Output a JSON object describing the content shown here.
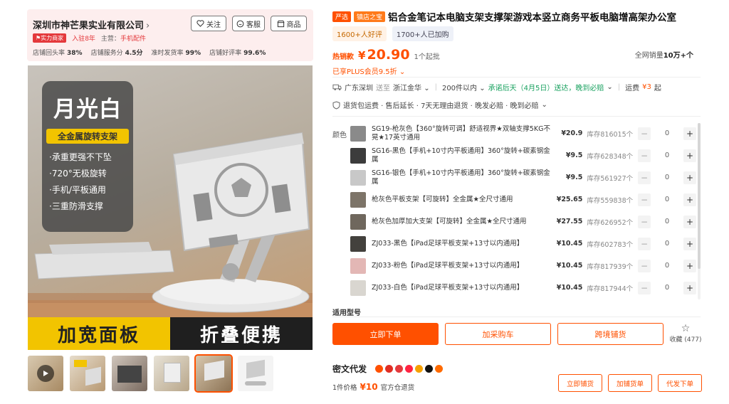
{
  "shop": {
    "name": "深圳市神芒果实业有限公司",
    "follow_label": "关注",
    "service_label": "客服",
    "store_label": "商品",
    "badge": "实力商家",
    "years_label": "入驻",
    "years_value": "8年",
    "business_label": "主营：",
    "business_value": "手机配件",
    "stats": [
      {
        "label": "店铺回头率",
        "value": "38%"
      },
      {
        "label": "店铺服务分",
        "value": "4.5分"
      },
      {
        "label": "准时发货率",
        "value": "99%"
      },
      {
        "label": "店铺好评率",
        "value": "99.6%"
      }
    ]
  },
  "image": {
    "badge_title": "月光白",
    "badge_sub": "全金属旋转支架",
    "features": [
      "·承重更强不下坠",
      "·720°无极旋转",
      "·手机/平板通用",
      "·三重防滑支撑"
    ],
    "banner_left": "加宽面板",
    "banner_right": "折叠便携"
  },
  "thumbnails": [
    "video",
    "thumb-2",
    "thumb-3",
    "thumb-4",
    "thumb-5",
    "thumb-6"
  ],
  "product": {
    "tag_strict": "严选",
    "tag_town": "镇店之宝",
    "title": "铝合金笔记本电脑支架支撑架游戏本竖立商务平板电脑增高架办公室",
    "review_good": "1600+人好评",
    "review_cart": "1700+人已加购",
    "price_label": "热销款",
    "price_symbol": "¥",
    "price": "20.90",
    "min_order": "1个起批",
    "sales_label": "全网销量",
    "sales_value": "10万+个",
    "plus_discount": "已享PLUS会员9.5折"
  },
  "shipping": {
    "from": "广东深圳",
    "to_label": "送至",
    "to": "浙江金华",
    "qty_range": "200件以内",
    "promise": "承诺后天（4月5日）送达，晚到必赔",
    "fee_label": "运费",
    "fee_value": "¥3",
    "fee_unit": "起"
  },
  "services": "退货包运费 · 售后延长 · 7天无理由退货 · 晚发必赔 · 晚到必赔",
  "color_label": "颜色",
  "skus": [
    {
      "name": "SG19-枪灰色【360°旋转可调】舒适视界★双轴支撑5KG不晃★17英寸通用",
      "price": "¥20.9",
      "stock": "库存816015个",
      "qty": "0",
      "color": "#8a8a8a"
    },
    {
      "name": "SG16-黑色【手机+10寸内平板通用】360°旋转+碳素钢金属",
      "price": "¥9.5",
      "stock": "库存628348个",
      "qty": "0",
      "color": "#3c3c3c"
    },
    {
      "name": "SG16-银色【手机+10寸内平板通用】360°旋转+碳素钢金属",
      "price": "¥9.5",
      "stock": "库存561927个",
      "qty": "0",
      "color": "#c8c8c8"
    },
    {
      "name": "枪灰色平板支架【可旋转】全金属★全尺寸通用",
      "price": "¥25.65",
      "stock": "库存559838个",
      "qty": "0",
      "color": "#7d7468"
    },
    {
      "name": "枪灰色加厚加大支架【可旋转】全金属★全尺寸通用",
      "price": "¥27.55",
      "stock": "库存626952个",
      "qty": "0",
      "color": "#6f675d"
    },
    {
      "name": "ZJ033-黑色【iPad足球平板支架+13寸以内通用】",
      "price": "¥10.45",
      "stock": "库存602783个",
      "qty": "0",
      "color": "#43413d"
    },
    {
      "name": "ZJ033-粉色【iPad足球平板支架+13寸以内通用】",
      "price": "¥10.45",
      "stock": "库存817939个",
      "qty": "0",
      "color": "#e3b7b5"
    },
    {
      "name": "ZJ033-白色【iPad足球平板支架+13寸以内通用】",
      "price": "¥10.45",
      "stock": "库存817944个",
      "qty": "0",
      "color": "#d9d6d0"
    }
  ],
  "model_label": "适用型号",
  "actions": {
    "buy_now": "立即下单",
    "add_cart": "加采购车",
    "cross_border": "跨境铺货",
    "favorite": "收藏",
    "favorite_count": "(477)"
  },
  "dropship": {
    "title": "密文代发",
    "price_label": "1件价格",
    "price": "¥10",
    "return_label": "官方仓退货",
    "btn_list": "立即铺货",
    "btn_add": "加铺货单",
    "btn_order": "代发下单"
  },
  "colors": {
    "accent": "#ff5000",
    "shop_bg": "#fdeeee",
    "green": "#1aa260"
  }
}
